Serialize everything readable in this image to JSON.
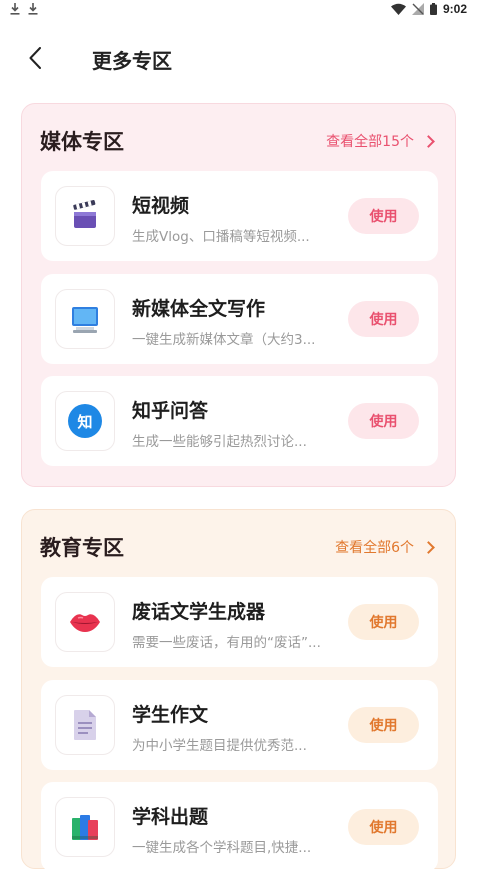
{
  "status_bar": {
    "time": "9:02"
  },
  "header": {
    "title": "更多专区"
  },
  "sections": [
    {
      "title": "媒体专区",
      "more_label": "查看全部15个",
      "items": [
        {
          "name": "短视频",
          "desc": "生成Vlog、口播稿等短视频...",
          "action": "使用",
          "icon": "clapperboard-icon"
        },
        {
          "name": "新媒体全文写作",
          "desc": "一键生成新媒体文章（大约3...",
          "action": "使用",
          "icon": "monitor-icon"
        },
        {
          "name": "知乎问答",
          "desc": "生成一些能够引起热烈讨论...",
          "action": "使用",
          "icon": "zhihu-icon",
          "badge_text": "知"
        }
      ]
    },
    {
      "title": "教育专区",
      "more_label": "查看全部6个",
      "items": [
        {
          "name": "废话文学生成器",
          "desc": "需要一些废话，有用的“废话”...",
          "action": "使用",
          "icon": "lips-icon"
        },
        {
          "name": "学生作文",
          "desc": "为中小学生题目提供优秀范...",
          "action": "使用",
          "icon": "document-icon"
        },
        {
          "name": "学科出题",
          "desc": "一键生成各个学科题目,快捷...",
          "action": "使用",
          "icon": "books-icon"
        }
      ]
    }
  ],
  "colors": {
    "media_accent": "#e9516f",
    "edu_accent": "#e1782e",
    "media_bg": "#fdeef1",
    "edu_bg": "#fdf3ea"
  }
}
